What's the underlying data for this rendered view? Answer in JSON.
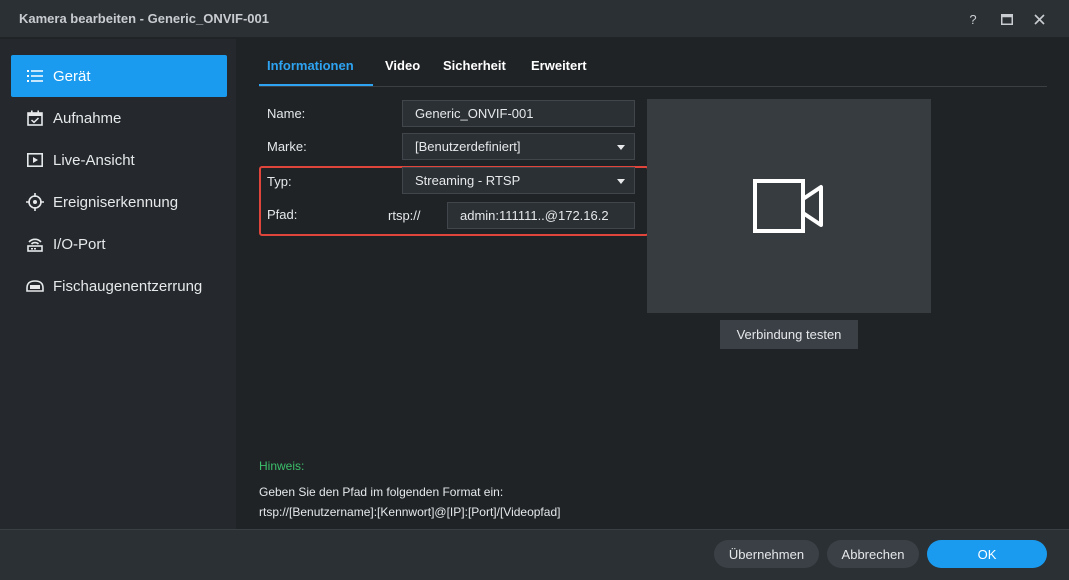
{
  "window": {
    "title": "Kamera bearbeiten - Generic_ONVIF-001",
    "help_label": "?"
  },
  "sidebar": {
    "items": [
      {
        "label": "Gerät",
        "icon": "list-icon",
        "active": true
      },
      {
        "label": "Aufnahme",
        "icon": "calendar-icon"
      },
      {
        "label": "Live-Ansicht",
        "icon": "play-icon"
      },
      {
        "label": "Ereigniserkennung",
        "icon": "crosshair-icon"
      },
      {
        "label": "I/O-Port",
        "icon": "wifi-port-icon"
      },
      {
        "label": "Fischaugenentzerrung",
        "icon": "fisheye-icon"
      }
    ]
  },
  "tabs": [
    {
      "label": "Informationen",
      "active": true
    },
    {
      "label": "Video"
    },
    {
      "label": "Sicherheit"
    },
    {
      "label": "Erweitert"
    }
  ],
  "form": {
    "name_label": "Name:",
    "name_value": "Generic_ONVIF-001",
    "brand_label": "Marke:",
    "brand_value": "[Benutzerdefiniert]",
    "type_label": "Typ:",
    "type_value": "Streaming - RTSP",
    "path_label": "Pfad:",
    "path_prefix": "rtsp://",
    "path_value": "admin:111111..@172.16.2"
  },
  "preview": {
    "icon": "video-camera-icon",
    "test_button": "Verbindung testen"
  },
  "hint": {
    "title": "Hinweis:",
    "line1": "Geben Sie den Pfad im folgenden Format ein:",
    "line2": "rtsp://[Benutzername]:[Kennwort]@[IP]:[Port]/[Videopfad]"
  },
  "footer": {
    "apply": "Übernehmen",
    "cancel": "Abbrechen",
    "ok": "OK"
  },
  "colors": {
    "accent": "#1a9bf0",
    "highlight_border": "#e0453c",
    "hint_green": "#3cbf6a"
  }
}
